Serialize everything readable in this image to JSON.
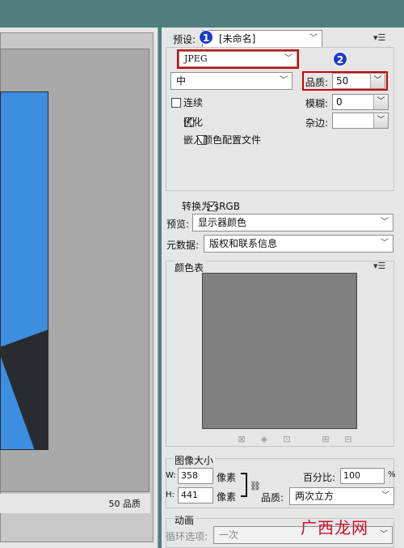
{
  "status": {
    "quality_label": "50 品质"
  },
  "settings": {
    "preset_label": "预设:",
    "preset_value": "[未命名]",
    "format_value": "JPEG",
    "compression_value": "中",
    "quality_label": "品质:",
    "quality_value": "50",
    "progressive_label": "连续",
    "blur_label": "模糊:",
    "blur_value": "0",
    "optimize_label": "优化",
    "matte_label": "杂边:",
    "embed_profile_label": "嵌入颜色配置文件",
    "convert_srgb_label": "转换为 sRGB",
    "preview_label": "预览:",
    "preview_value": "显示器颜色",
    "metadata_label": "元数据:",
    "metadata_value": "版权和联系信息"
  },
  "badges": [
    "1",
    "2"
  ],
  "color_table": {
    "title": "颜色表",
    "swatch_color": "#808080"
  },
  "image_size": {
    "title": "图像大小",
    "w_label": "W:",
    "w_value": "358",
    "h_label": "H:",
    "h_value": "441",
    "unit": "像素",
    "percent_label": "百分比:",
    "percent_value": "100",
    "percent_unit": "%",
    "quality_label": "品质:",
    "quality_value": "两次立方"
  },
  "animation": {
    "title": "动画",
    "loop_label": "循环选项:",
    "loop_value": "一次"
  },
  "watermark": "广西龙网",
  "colors": {
    "highlight": "#d40000",
    "badge": "#1a3cc8",
    "preview_blue": "#3c8ee0"
  }
}
